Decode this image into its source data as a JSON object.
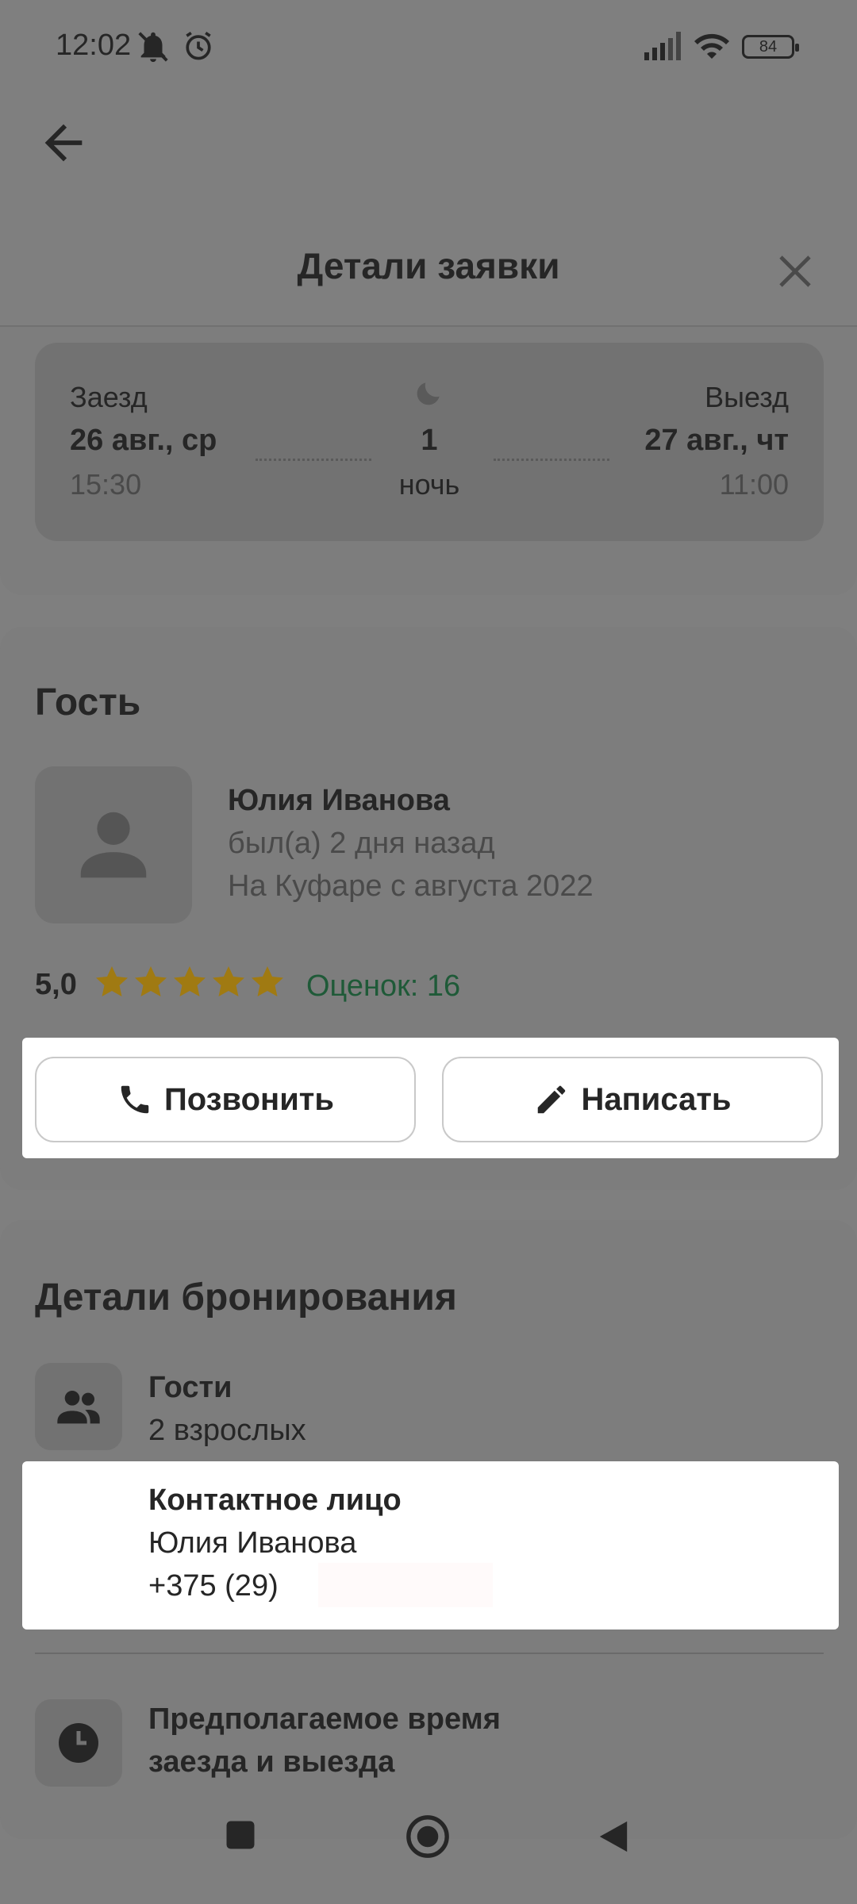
{
  "status_bar": {
    "time": "12:02",
    "battery": "84"
  },
  "header": {
    "title": "Детали заявки"
  },
  "dates": {
    "checkin_label": "Заезд",
    "checkin_date": "26 авг., ср",
    "checkin_time": "15:30",
    "nights_count": "1",
    "nights_label": "ночь",
    "checkout_label": "Выезд",
    "checkout_date": "27 авг., чт",
    "checkout_time": "11:00"
  },
  "guest": {
    "section_title": "Гость",
    "name": "Юлия Иванова",
    "last_seen": "был(а) 2 дня назад",
    "member_since": "На Куфаре с августа 2022",
    "rating": "5,0",
    "stars": 5,
    "reviews": "Оценок: 16",
    "call_label": "Позвонить",
    "message_label": "Написать"
  },
  "booking": {
    "section_title": "Детали бронирования",
    "guests_title": "Гости",
    "guests_value": "2 взрослых",
    "contact_title": "Контактное лицо",
    "contact_name": "Юлия Иванова",
    "contact_phone": "+375 (29)",
    "time_title_line1": "Предполагаемое время",
    "time_title_line2": "заезда и выезда"
  },
  "colors": {
    "overlay": "#7f7f7f",
    "reviews": "#1f5a38",
    "star": "#a07a12",
    "highlight": "#ffffff"
  }
}
